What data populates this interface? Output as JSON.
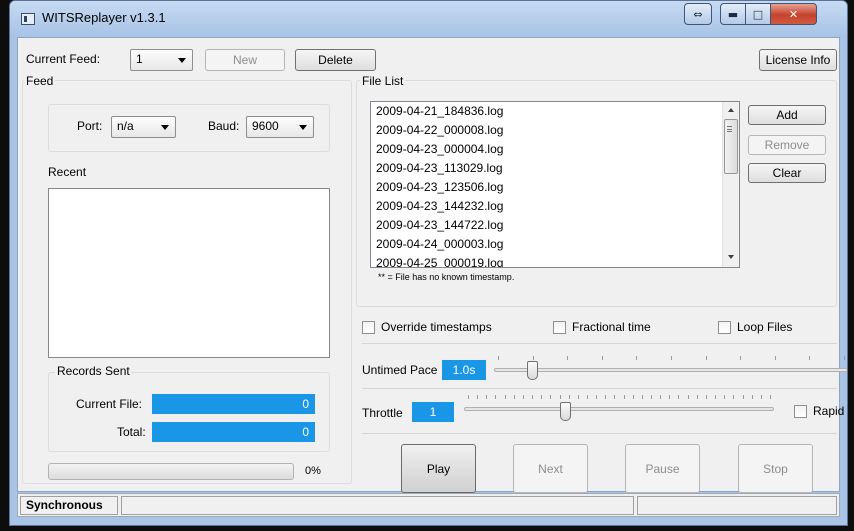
{
  "window": {
    "title": "WITSReplayer v1.3.1"
  },
  "top": {
    "current_feed_label": "Current Feed:",
    "current_feed_value": "1",
    "new_label": "New",
    "delete_label": "Delete",
    "license_label": "License Info"
  },
  "feed": {
    "group_label": "Feed",
    "port_label": "Port:",
    "port_value": "n/a",
    "baud_label": "Baud:",
    "baud_value": "9600",
    "recent_label": "Recent"
  },
  "records": {
    "group_label": "Records Sent",
    "current_file_label": "Current File:",
    "current_file_value": "0",
    "total_label": "Total:",
    "total_value": "0",
    "progress_text": "0%",
    "progress_percent": 0
  },
  "file_list": {
    "group_label": "File List",
    "files": [
      "2009-04-21_184836.log",
      "2009-04-22_000008.log",
      "2009-04-23_000004.log",
      "2009-04-23_113029.log",
      "2009-04-23_123506.log",
      "2009-04-23_144232.log",
      "2009-04-23_144722.log",
      "2009-04-24_000003.log",
      "2009-04-25_000019.log"
    ],
    "note": "** = File has no known timestamp.",
    "add_label": "Add",
    "remove_label": "Remove",
    "clear_label": "Clear"
  },
  "options": {
    "override_label": "Override timestamps",
    "fractional_label": "Fractional time",
    "loop_label": "Loop Files",
    "untimed_label": "Untimed Pace",
    "untimed_value": "1.0s",
    "throttle_label": "Throttle",
    "throttle_value": "1",
    "rapid_label": "Rapid"
  },
  "controls": {
    "play_label": "Play",
    "next_label": "Next",
    "pause_label": "Pause",
    "stop_label": "Stop"
  },
  "status": {
    "mode": "Synchronous"
  }
}
